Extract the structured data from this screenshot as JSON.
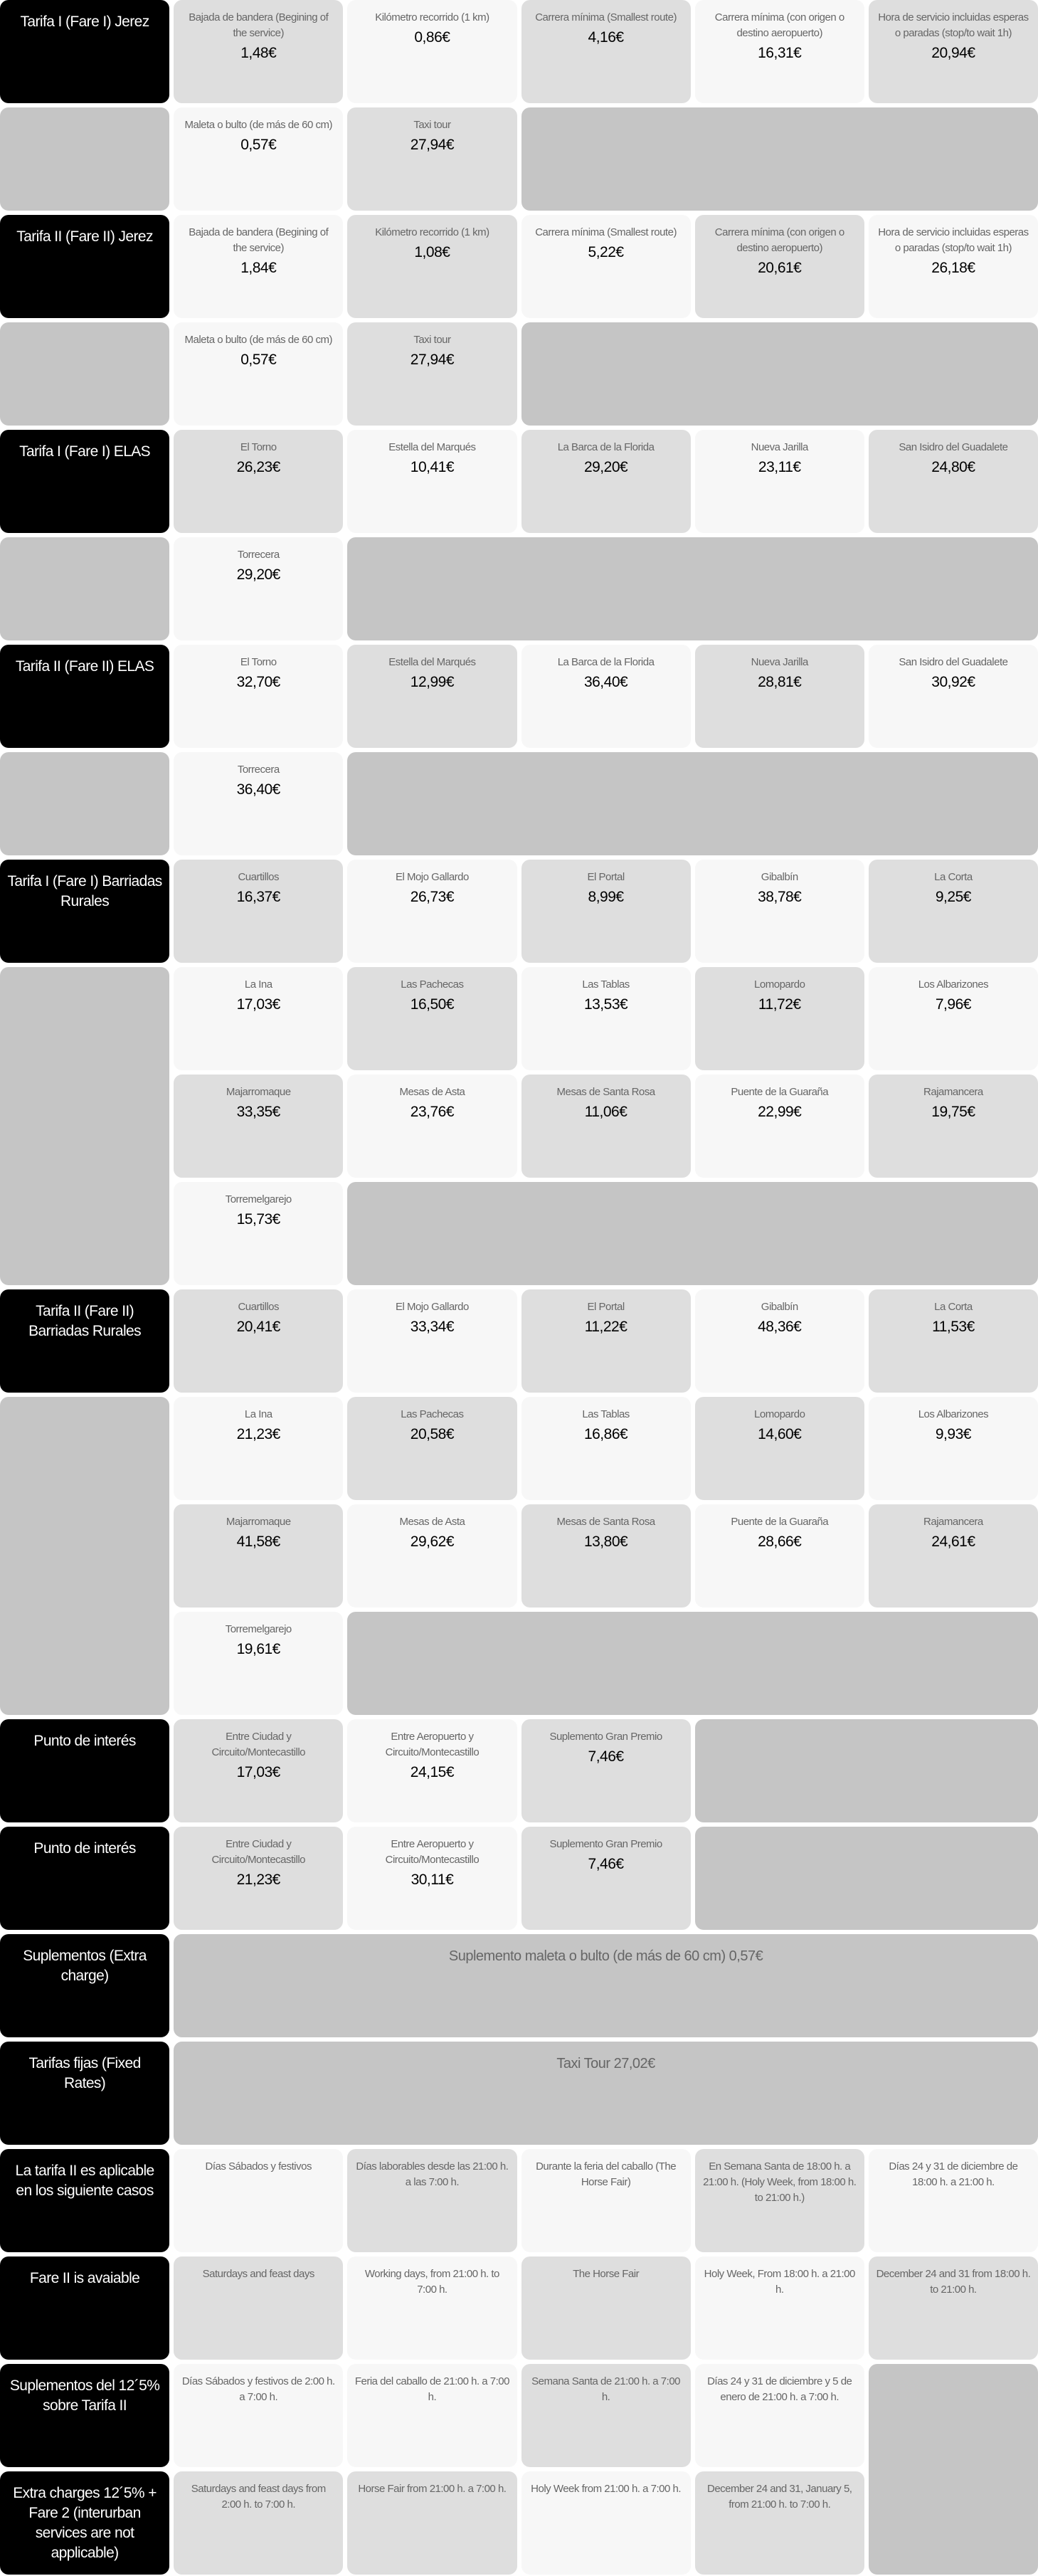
{
  "colors": {
    "header": "#000000",
    "light": "#f7f7f7",
    "mid": "#dedede",
    "dark": "#c5c5c5"
  },
  "groups": [
    {
      "title": "Tarifa I (Fare I) Jerez",
      "cells": [
        {
          "label": "Bajada de bandera (Begining of the service)",
          "price": "1,48€",
          "tone": "mid"
        },
        {
          "label": "Kilómetro recorrido (1 km)",
          "price": "0,86€",
          "tone": "light"
        },
        {
          "label": "Carrera mínima (Smallest route)",
          "price": "4,16€",
          "tone": "mid"
        },
        {
          "label": "Carrera mínima (con origen o destino aeropuerto)",
          "price": "16,31€",
          "tone": "light"
        },
        {
          "label": "Hora de servicio incluidas esperas o paradas (stop/to wait 1h)",
          "price": "20,94€",
          "tone": "mid"
        },
        {
          "label": "Maleta o bulto (de más de 60 cm)",
          "price": "0,57€",
          "tone": "light"
        },
        {
          "label": "Taxi tour",
          "price": "27,94€",
          "tone": "mid"
        }
      ]
    },
    {
      "title": "Tarifa II (Fare II) Jerez",
      "cells": [
        {
          "label": "Bajada de bandera (Begining of the service)",
          "price": "1,84€",
          "tone": "light"
        },
        {
          "label": "Kilómetro recorrido (1 km)",
          "price": "1,08€",
          "tone": "mid"
        },
        {
          "label": "Carrera mínima (Smallest route)",
          "price": "5,22€",
          "tone": "light"
        },
        {
          "label": "Carrera mínima (con origen o destino aeropuerto)",
          "price": "20,61€",
          "tone": "mid"
        },
        {
          "label": "Hora de servicio incluidas esperas o paradas (stop/to wait 1h)",
          "price": "26,18€",
          "tone": "light"
        },
        {
          "label": "Maleta o bulto (de más de 60 cm)",
          "price": "0,57€",
          "tone": "light"
        },
        {
          "label": "Taxi tour",
          "price": "27,94€",
          "tone": "mid"
        }
      ]
    },
    {
      "title": "Tarifa I (Fare I) ELAS",
      "cells": [
        {
          "label": "El Torno",
          "price": "26,23€",
          "tone": "mid"
        },
        {
          "label": "Estella del Marqués",
          "price": "10,41€",
          "tone": "light"
        },
        {
          "label": "La Barca de la Florida",
          "price": "29,20€",
          "tone": "mid"
        },
        {
          "label": "Nueva Jarilla",
          "price": "23,11€",
          "tone": "light"
        },
        {
          "label": "San Isidro del Guadalete",
          "price": "24,80€",
          "tone": "mid"
        },
        {
          "label": "Torrecera",
          "price": "29,20€",
          "tone": "light"
        }
      ]
    },
    {
      "title": "Tarifa II (Fare II) ELAS",
      "cells": [
        {
          "label": "El Torno",
          "price": "32,70€",
          "tone": "light"
        },
        {
          "label": "Estella del Marqués",
          "price": "12,99€",
          "tone": "mid"
        },
        {
          "label": "La Barca de la Florida",
          "price": "36,40€",
          "tone": "light"
        },
        {
          "label": "Nueva Jarilla",
          "price": "28,81€",
          "tone": "mid"
        },
        {
          "label": "San Isidro del Guadalete",
          "price": "30,92€",
          "tone": "light"
        },
        {
          "label": "Torrecera",
          "price": "36,40€",
          "tone": "light"
        }
      ]
    },
    {
      "title": "Tarifa I (Fare I) Barriadas Rurales",
      "cells": [
        {
          "label": "Cuartillos",
          "price": "16,37€",
          "tone": "mid"
        },
        {
          "label": "El Mojo Gallardo",
          "price": "26,73€",
          "tone": "light"
        },
        {
          "label": "El Portal",
          "price": "8,99€",
          "tone": "mid"
        },
        {
          "label": "Gibalbín",
          "price": "38,78€",
          "tone": "light"
        },
        {
          "label": "La Corta",
          "price": "9,25€",
          "tone": "mid"
        },
        {
          "label": "La Ina",
          "price": "17,03€",
          "tone": "light"
        },
        {
          "label": "Las Pachecas",
          "price": "16,50€",
          "tone": "mid"
        },
        {
          "label": "Las Tablas",
          "price": "13,53€",
          "tone": "light"
        },
        {
          "label": "Lomopardo",
          "price": "11,72€",
          "tone": "mid"
        },
        {
          "label": "Los Albarizones",
          "price": "7,96€",
          "tone": "light"
        },
        {
          "label": "Majarromaque",
          "price": "33,35€",
          "tone": "mid"
        },
        {
          "label": "Mesas de Asta",
          "price": "23,76€",
          "tone": "light"
        },
        {
          "label": "Mesas de Santa Rosa",
          "price": "11,06€",
          "tone": "mid"
        },
        {
          "label": "Puente de la Guaraña",
          "price": "22,99€",
          "tone": "light"
        },
        {
          "label": "Rajamancera",
          "price": "19,75€",
          "tone": "mid"
        },
        {
          "label": "Torremelgarejo",
          "price": "15,73€",
          "tone": "light"
        }
      ]
    },
    {
      "title": "Tarifa II (Fare II) Barriadas Rurales",
      "cells": [
        {
          "label": "Cuartillos",
          "price": "20,41€",
          "tone": "mid"
        },
        {
          "label": "El Mojo Gallardo",
          "price": "33,34€",
          "tone": "light"
        },
        {
          "label": "El Portal",
          "price": "11,22€",
          "tone": "mid"
        },
        {
          "label": "Gibalbín",
          "price": "48,36€",
          "tone": "light"
        },
        {
          "label": "La Corta",
          "price": "11,53€",
          "tone": "mid"
        },
        {
          "label": "La Ina",
          "price": "21,23€",
          "tone": "light"
        },
        {
          "label": "Las Pachecas",
          "price": "20,58€",
          "tone": "mid"
        },
        {
          "label": "Las Tablas",
          "price": "16,86€",
          "tone": "light"
        },
        {
          "label": "Lomopardo",
          "price": "14,60€",
          "tone": "mid"
        },
        {
          "label": "Los Albarizones",
          "price": "9,93€",
          "tone": "light"
        },
        {
          "label": "Majarromaque",
          "price": "41,58€",
          "tone": "mid"
        },
        {
          "label": "Mesas de Asta",
          "price": "29,62€",
          "tone": "light"
        },
        {
          "label": "Mesas de Santa Rosa",
          "price": "13,80€",
          "tone": "mid"
        },
        {
          "label": "Puente de la Guaraña",
          "price": "28,66€",
          "tone": "light"
        },
        {
          "label": "Rajamancera",
          "price": "24,61€",
          "tone": "mid"
        },
        {
          "label": "Torremelgarejo",
          "price": "19,61€",
          "tone": "light"
        }
      ]
    },
    {
      "title": "Punto de interés",
      "cells": [
        {
          "label": "Entre Ciudad y Circuito/Montecastillo",
          "price": "17,03€",
          "tone": "mid"
        },
        {
          "label": "Entre Aeropuerto y Circuito/Montecastillo",
          "price": "24,15€",
          "tone": "light"
        },
        {
          "label": "Suplemento Gran Premio",
          "price": "7,46€",
          "tone": "mid"
        }
      ]
    },
    {
      "title": "Punto de interés",
      "cells": [
        {
          "label": "Entre Ciudad y Circuito/Montecastillo",
          "price": "21,23€",
          "tone": "mid"
        },
        {
          "label": "Entre Aeropuerto y Circuito/Montecastillo",
          "price": "30,11€",
          "tone": "light"
        },
        {
          "label": "Suplemento Gran Premio",
          "price": "7,46€",
          "tone": "mid"
        }
      ]
    },
    {
      "title": "Suplementos (Extra charge)",
      "wide": {
        "label": "Suplemento maleta o bulto (de más de 60 cm) 0,57€",
        "tone": "dark"
      }
    },
    {
      "title": "Tarifas fijas (Fixed Rates)",
      "wide": {
        "label": "Taxi Tour 27,02€",
        "tone": "dark"
      }
    },
    {
      "title": "La tarifa II es aplicable en los siguiente casos",
      "cells": [
        {
          "label": "Días Sábados y festivos",
          "tone": "light"
        },
        {
          "label": "Días laborables desde las 21:00 h. a las 7:00 h.",
          "tone": "mid"
        },
        {
          "label": "Durante la feria del caballo (The Horse Fair)",
          "tone": "light"
        },
        {
          "label": "En Semana Santa de 18:00 h. a 21:00 h. (Holy Week, from 18:00 h. to 21:00 h.)",
          "tone": "mid"
        },
        {
          "label": "Días 24 y 31 de diciembre de 18:00 h. a 21:00 h.",
          "tone": "light"
        }
      ]
    },
    {
      "title": "Fare II is avaiable",
      "cells": [
        {
          "label": "Saturdays and feast days",
          "tone": "mid"
        },
        {
          "label": "Working days, from 21:00 h. to 7:00 h.",
          "tone": "light"
        },
        {
          "label": "The Horse Fair",
          "tone": "mid"
        },
        {
          "label": "Holy Week, From 18:00 h. a 21:00 h.",
          "tone": "light"
        },
        {
          "label": "December 24 and 31 from 18:00 h. to 21:00 h.",
          "tone": "mid"
        }
      ]
    },
    {
      "title": "Suplementos del 12´5% sobre Tarifa II",
      "fillerRows": 2,
      "cells": [
        {
          "label": "Días Sábados y festivos de 2:00 h. a 7:00 h.",
          "tone": "light"
        },
        {
          "label": "Feria del caballo de 21:00 h. a 7:00 h.",
          "tone": "light"
        },
        {
          "label": "Semana Santa de 21:00 h. a 7:00 h.",
          "tone": "mid"
        },
        {
          "label": "Días 24 y 31 de diciembre y 5 de enero de 21:00 h. a 7:00 h.",
          "tone": "light"
        }
      ]
    },
    {
      "title": "Extra charges 12´5% + Fare 2 (interurban services are not applicable)",
      "noFiller": true,
      "cells": [
        {
          "label": "Saturdays and feast days from 2:00 h. to 7:00 h.",
          "tone": "mid"
        },
        {
          "label": "Horse Fair from 21:00 h. a 7:00 h.",
          "tone": "mid"
        },
        {
          "label": "Holy Week from 21:00 h. a 7:00 h.",
          "tone": "light"
        },
        {
          "label": "December 24 and 31, January 5, from 21:00 h. to 7:00 h.",
          "tone": "mid"
        }
      ]
    }
  ]
}
